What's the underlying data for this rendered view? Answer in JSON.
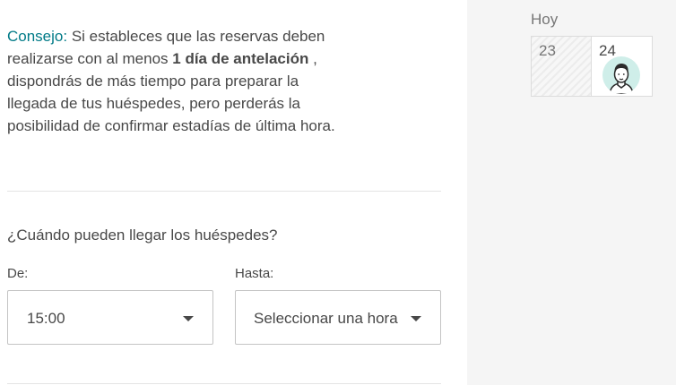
{
  "tip": {
    "lead": "Consejo:",
    "text_before": " Si estableces que las reservas deben realizarse con al menos ",
    "bold": "1 día de antelación",
    "text_after": " , dispondrás de más tiempo para preparar la llegada de tus huéspedes, pero perderás la posibilidad de confirmar estadías de última hora."
  },
  "arrival": {
    "question": "¿Cuándo pueden llegar los huéspedes?",
    "from_label": "De:",
    "from_value": "15:00",
    "to_label": "Hasta:",
    "to_value": "Seleccionar una hora"
  },
  "calendar": {
    "today_label": "Hoy",
    "days": [
      "23",
      "24"
    ]
  },
  "colors": {
    "accent": "#007a87",
    "text": "#484848",
    "sidebar_bg": "#f5f5f5"
  },
  "icons": {
    "dropdown": "caret-down-icon",
    "host": "avatar"
  }
}
